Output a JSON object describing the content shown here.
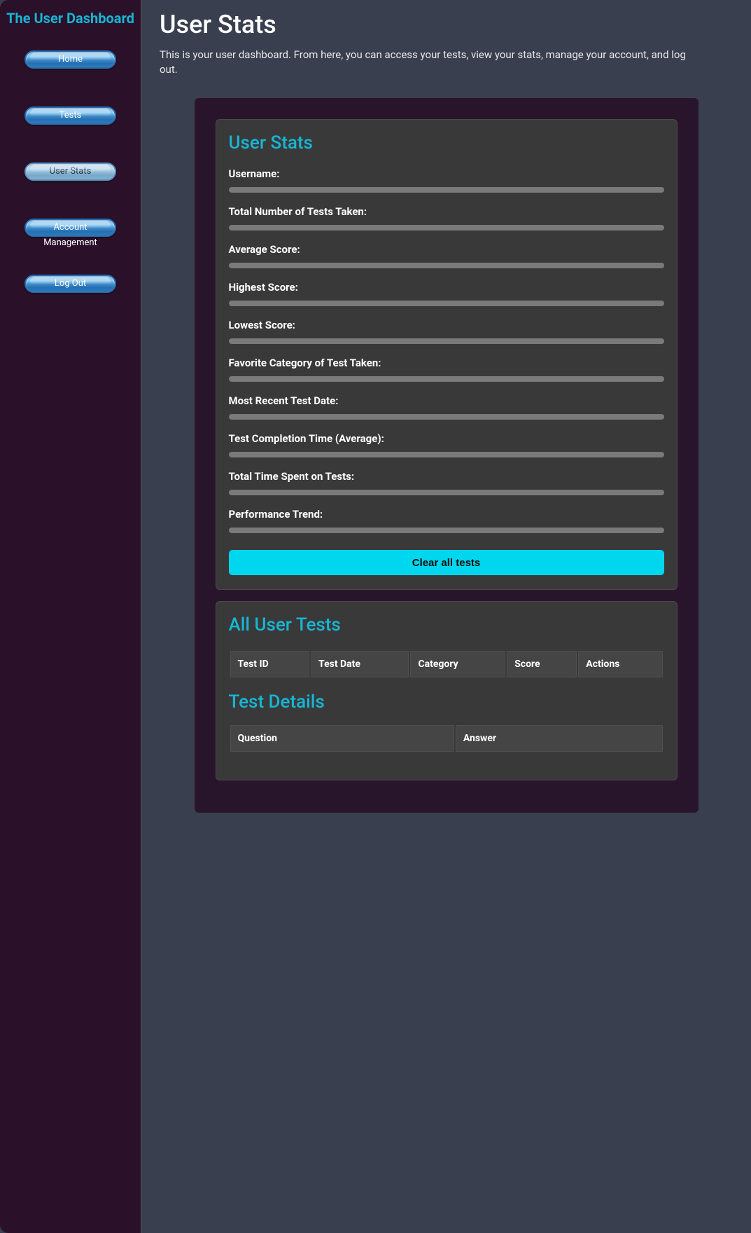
{
  "sidebar": {
    "title": "The User Dashboard",
    "items": [
      {
        "label": "Home",
        "active": false
      },
      {
        "label": "Tests",
        "active": false
      },
      {
        "label": "User Stats",
        "active": true
      },
      {
        "label": "Account Management",
        "active": false
      },
      {
        "label": "Log Out",
        "active": false
      }
    ]
  },
  "page": {
    "title": "User Stats",
    "description": "This is your user dashboard. From here, you can access your tests, view your stats, manage your account, and log out."
  },
  "stats_card": {
    "heading": "User Stats",
    "fields": [
      {
        "label": "Username:"
      },
      {
        "label": "Total Number of Tests Taken:"
      },
      {
        "label": "Average Score:"
      },
      {
        "label": "Highest Score:"
      },
      {
        "label": "Lowest Score:"
      },
      {
        "label": "Favorite Category of Test Taken:"
      },
      {
        "label": "Most Recent Test Date:"
      },
      {
        "label": "Test Completion Time (Average):"
      },
      {
        "label": "Total Time Spent on Tests:"
      },
      {
        "label": "Performance Trend:"
      }
    ],
    "clear_button": "Clear all tests"
  },
  "tests_card": {
    "heading": "All User Tests",
    "columns": [
      "Test ID",
      "Test Date",
      "Category",
      "Score",
      "Actions"
    ]
  },
  "details_card": {
    "heading": "Test Details",
    "columns": [
      "Question",
      "Answer"
    ]
  }
}
